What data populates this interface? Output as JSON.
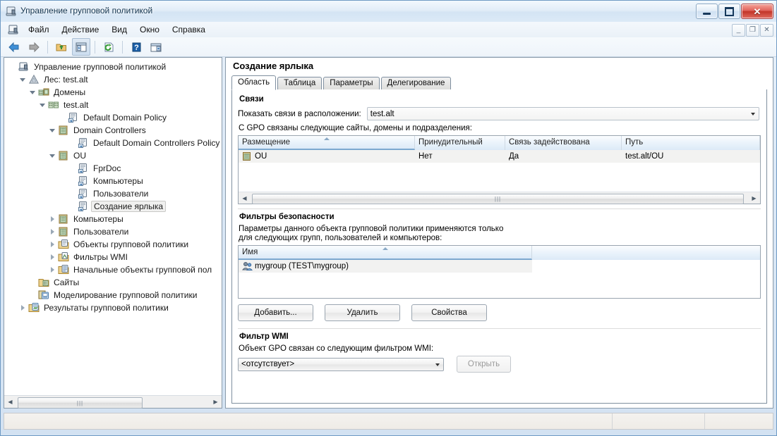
{
  "window": {
    "title": "Управление групповой политикой",
    "icon": "gpmc-icon",
    "minimize_label": "—",
    "maximize_label": "□",
    "close_label": "✕"
  },
  "menubar": {
    "items": [
      {
        "label": "Файл",
        "name": "menu-file"
      },
      {
        "label": "Действие",
        "name": "menu-action"
      },
      {
        "label": "Вид",
        "name": "menu-view"
      },
      {
        "label": "Окно",
        "name": "menu-window"
      },
      {
        "label": "Справка",
        "name": "menu-help"
      }
    ],
    "mdi_buttons": [
      {
        "label": "_",
        "name": "mdi-minimize-button"
      },
      {
        "label": "❐",
        "name": "mdi-restore-button"
      },
      {
        "label": "✕",
        "name": "mdi-close-button"
      }
    ]
  },
  "toolbar": {
    "buttons": [
      {
        "name": "back-icon",
        "title": "Назад"
      },
      {
        "name": "forward-icon",
        "title": "Вперед"
      },
      {
        "name": "up-folder-icon",
        "title": "Вверх"
      },
      {
        "name": "show-hide-tree-icon",
        "title": "Показать/скрыть дерево"
      },
      {
        "name": "refresh-icon",
        "title": "Обновить"
      },
      {
        "name": "help-icon",
        "title": "Справка"
      },
      {
        "name": "export-list-icon",
        "title": "Экспорт списка"
      }
    ]
  },
  "tree": {
    "nodes": [
      {
        "label": "Управление групповой политикой",
        "indent": 0,
        "expander": "none",
        "icon": "gpmc-icon",
        "selected": false
      },
      {
        "label": "Лес: test.alt",
        "indent": 1,
        "expander": "open",
        "icon": "forest-icon",
        "selected": false
      },
      {
        "label": "Домены",
        "indent": 2,
        "expander": "open",
        "icon": "domains-icon",
        "selected": false
      },
      {
        "label": "test.alt",
        "indent": 3,
        "expander": "open",
        "icon": "domain-icon",
        "selected": false
      },
      {
        "label": "Default Domain Policy",
        "indent": 5,
        "expander": "none",
        "icon": "gpo-icon",
        "selected": false
      },
      {
        "label": "Domain Controllers",
        "indent": 4,
        "expander": "open",
        "icon": "ou-icon",
        "selected": false
      },
      {
        "label": "Default Domain Controllers Policy",
        "indent": 6,
        "expander": "none",
        "icon": "gpo-icon",
        "selected": false
      },
      {
        "label": "OU",
        "indent": 4,
        "expander": "open",
        "icon": "ou-icon",
        "selected": false
      },
      {
        "label": "FprDoc",
        "indent": 6,
        "expander": "none",
        "icon": "gpo-icon",
        "selected": false
      },
      {
        "label": "Компьютеры",
        "indent": 6,
        "expander": "none",
        "icon": "gpo-icon",
        "selected": false
      },
      {
        "label": "Пользователи",
        "indent": 6,
        "expander": "none",
        "icon": "gpo-icon",
        "selected": false
      },
      {
        "label": "Создание ярлыка",
        "indent": 6,
        "expander": "none",
        "icon": "gpo-icon",
        "selected": true
      },
      {
        "label": "Компьютеры",
        "indent": 4,
        "expander": "closed",
        "icon": "ou-icon",
        "selected": false
      },
      {
        "label": "Пользователи",
        "indent": 4,
        "expander": "closed",
        "icon": "ou-icon",
        "selected": false
      },
      {
        "label": "Объекты групповой политики",
        "indent": 4,
        "expander": "closed",
        "icon": "gpo-folder-icon",
        "selected": false
      },
      {
        "label": "Фильтры WMI",
        "indent": 4,
        "expander": "closed",
        "icon": "wmi-folder-icon",
        "selected": false
      },
      {
        "label": "Начальные объекты групповой пол",
        "indent": 4,
        "expander": "closed",
        "icon": "starter-gpo-icon",
        "selected": false
      },
      {
        "label": "Сайты",
        "indent": 2,
        "expander": "none",
        "icon": "sites-icon",
        "selected": false
      },
      {
        "label": "Моделирование групповой политики",
        "indent": 2,
        "expander": "none",
        "icon": "modeling-icon",
        "selected": false
      },
      {
        "label": "Результаты групповой политики",
        "indent": 1,
        "expander": "closed",
        "icon": "results-icon",
        "selected": false
      }
    ],
    "scrollbar": {
      "left_arrow": "◀",
      "right_arrow": "▶",
      "thumb_grip": "|||"
    }
  },
  "detail": {
    "title": "Создание ярлыка",
    "tabs": [
      {
        "label": "Область",
        "active": true,
        "name": "tab-scope"
      },
      {
        "label": "Таблица",
        "active": false,
        "name": "tab-details"
      },
      {
        "label": "Параметры",
        "active": false,
        "name": "tab-settings"
      },
      {
        "label": "Делегирование",
        "active": false,
        "name": "tab-delegation"
      }
    ],
    "links": {
      "group_title": "Связи",
      "location_label": "Показать связи в расположении:",
      "location_value": "test.alt",
      "caption": "С GPO связаны следующие сайты, домены и подразделения:",
      "columns": [
        "Размещение",
        "Принудительный",
        "Связь задействована",
        "Путь"
      ],
      "sorted_column": 0,
      "rows": [
        {
          "location": "OU",
          "enforced": "Нет",
          "link_enabled": "Да",
          "path": "test.alt/OU",
          "icon": "ou-icon"
        }
      ]
    },
    "security": {
      "group_title": "Фильтры безопасности",
      "caption_line1": "Параметры данного объекта групповой политики применяются только",
      "caption_line2": "для следующих групп, пользователей и компьютеров:",
      "columns": [
        "Имя"
      ],
      "sorted_column": 0,
      "rows": [
        {
          "name": "mygroup (TEST\\mygroup)",
          "icon": "group-icon"
        }
      ],
      "buttons": [
        {
          "label": "Добавить...",
          "name": "add-button",
          "disabled": false
        },
        {
          "label": "Удалить",
          "name": "remove-button",
          "disabled": false
        },
        {
          "label": "Свойства",
          "name": "properties-button",
          "disabled": false
        }
      ]
    },
    "wmi": {
      "group_title": "Фильтр WMI",
      "caption": "Объект GPO связан со следующим фильтром WMI:",
      "filter_value": "<отсутствует>",
      "open_button": "Открыть",
      "open_disabled": true
    }
  },
  "statusbar": {
    "cells": [
      "",
      "",
      ""
    ]
  }
}
